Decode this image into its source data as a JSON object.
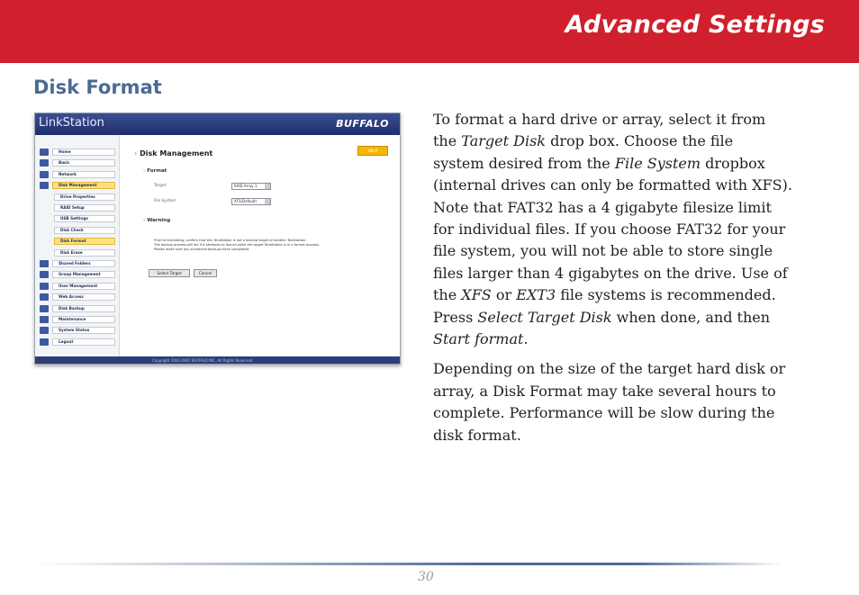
{
  "header": {
    "title": "Advanced Settings"
  },
  "section": {
    "title": "Disk Format"
  },
  "screenshot": {
    "logo": "LinkStation",
    "brand": "BUFFALO",
    "nav": [
      {
        "label": "Home",
        "sub": false,
        "active": false
      },
      {
        "label": "Basic",
        "sub": false,
        "active": false
      },
      {
        "label": "Network",
        "sub": false,
        "active": false
      },
      {
        "label": "Disk Management",
        "sub": false,
        "active": true
      },
      {
        "label": "Drive Properties",
        "sub": true,
        "active": false
      },
      {
        "label": "RAID Setup",
        "sub": true,
        "active": false
      },
      {
        "label": "USB Settings",
        "sub": true,
        "active": false
      },
      {
        "label": "Disk Check",
        "sub": true,
        "active": false
      },
      {
        "label": "Disk Format",
        "sub": true,
        "active": true
      },
      {
        "label": "Disk Erase",
        "sub": true,
        "active": false
      },
      {
        "label": "Shared Folders",
        "sub": false,
        "active": false
      },
      {
        "label": "Group Management",
        "sub": false,
        "active": false
      },
      {
        "label": "User Management",
        "sub": false,
        "active": false
      },
      {
        "label": "Web Access",
        "sub": false,
        "active": false
      },
      {
        "label": "Disk Backup",
        "sub": false,
        "active": false
      },
      {
        "label": "Maintenance",
        "sub": false,
        "active": false
      },
      {
        "label": "System Status",
        "sub": false,
        "active": false
      },
      {
        "label": "Logout",
        "sub": false,
        "active": false
      }
    ],
    "page_title": "Disk Management",
    "help": "HELP",
    "format_heading": "Format",
    "target_label": "Target",
    "target_value": "RAID Array 1",
    "fs_label": "File System",
    "fs_value": "XFS(Default)",
    "warning_heading": "Warning",
    "warning_lines": [
      "Prior to formatting, confirm that this TeraStation is not a backup target of another TeraStation.",
      "The backup process will fail if it attempts to launch while the target TeraStation is in a format process.",
      "Please make sure any scheduled backups have completed."
    ],
    "select_target_button": "Select Target",
    "cancel_button": "Cancel",
    "copyright": "Copyright 2002-2007 BUFFALO INC. All Rights Reserved."
  },
  "body": {
    "paragraph1": [
      [
        "To format a hard drive or array, select it from"
      ],
      [
        "the ",
        {
          "i": "Target Disk"
        },
        " drop box.  Choose the file"
      ],
      [
        "system desired from the ",
        {
          "i": "File System"
        },
        " dropbox"
      ],
      [
        "(internal drives can only be formatted with XFS)."
      ],
      [
        "Note that FAT32 has a 4 gigabyte filesize limit"
      ],
      [
        "for individual files.  If you choose FAT32 for your"
      ],
      [
        "file system, you will not be able to store single"
      ],
      [
        "files larger than 4 gigabytes on the drive.  Use of"
      ],
      [
        "the ",
        {
          "i": "XFS"
        },
        " or ",
        {
          "i": "EXT3"
        },
        " file systems is recommended."
      ],
      [
        "Press ",
        {
          "i": "Select Target Disk"
        },
        " when done, and then"
      ],
      [
        {
          "i": "Start format."
        }
      ]
    ],
    "paragraph2": [
      [
        "Depending on the size of the target hard disk or"
      ],
      [
        "array, a Disk Format may take several hours to"
      ],
      [
        "complete.  Performance will be slow during the"
      ],
      [
        "disk format."
      ]
    ]
  },
  "footer": {
    "page_number": "30"
  },
  "colors": {
    "banner": "#d0202e",
    "section_title": "#4c6a95",
    "rule": "#4d6a95"
  }
}
